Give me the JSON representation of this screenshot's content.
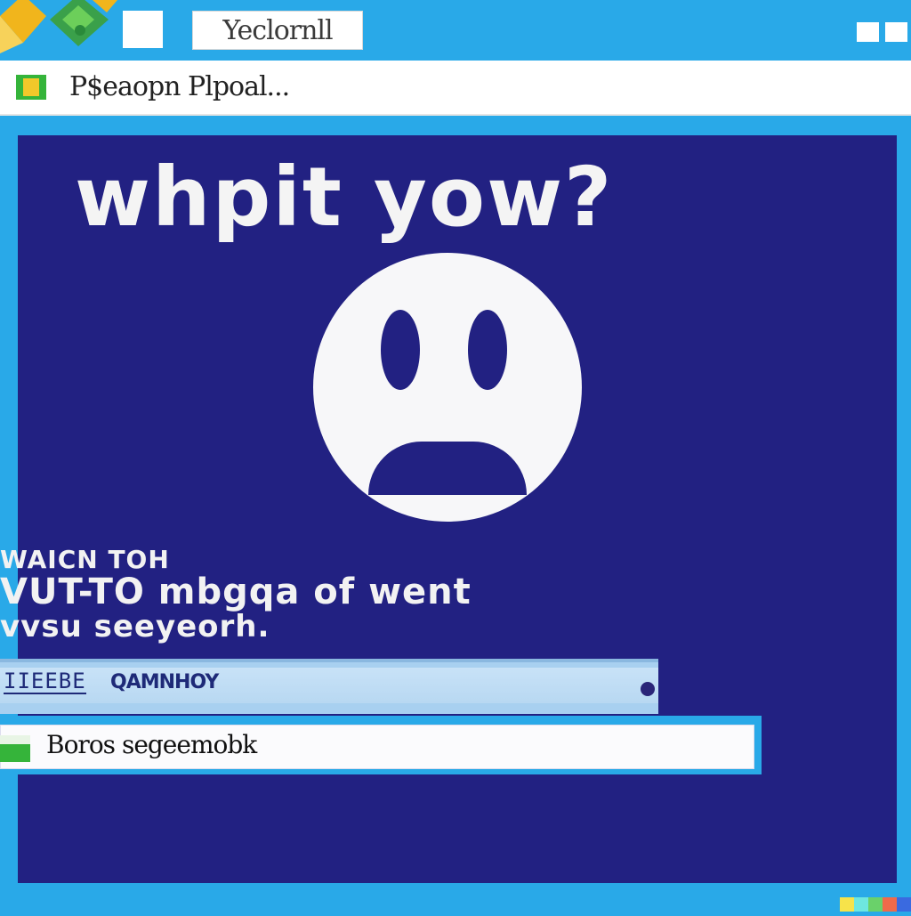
{
  "window": {
    "title": "Yeclornll",
    "controls": [
      "minimize",
      "close"
    ]
  },
  "pathbar": {
    "icon": "folder-icon",
    "text": "P$eaopn Plpoal..."
  },
  "error": {
    "headline": "whpit yow?",
    "face_icon": "sad-face-icon",
    "message_lines": [
      "WAICN TOH",
      "VUT-TO mbgqa of went",
      "vvsu seeyeorh."
    ]
  },
  "progress": {
    "code": "IIEEBE",
    "label": "QAMNHOY"
  },
  "action": {
    "icon": "green-square-icon",
    "text": "Boros segeemobk"
  },
  "colors": {
    "frame": "#29a9e8",
    "panel": "#222182",
    "text_light": "#f4f4f4",
    "accent_green": "#35b43a"
  }
}
